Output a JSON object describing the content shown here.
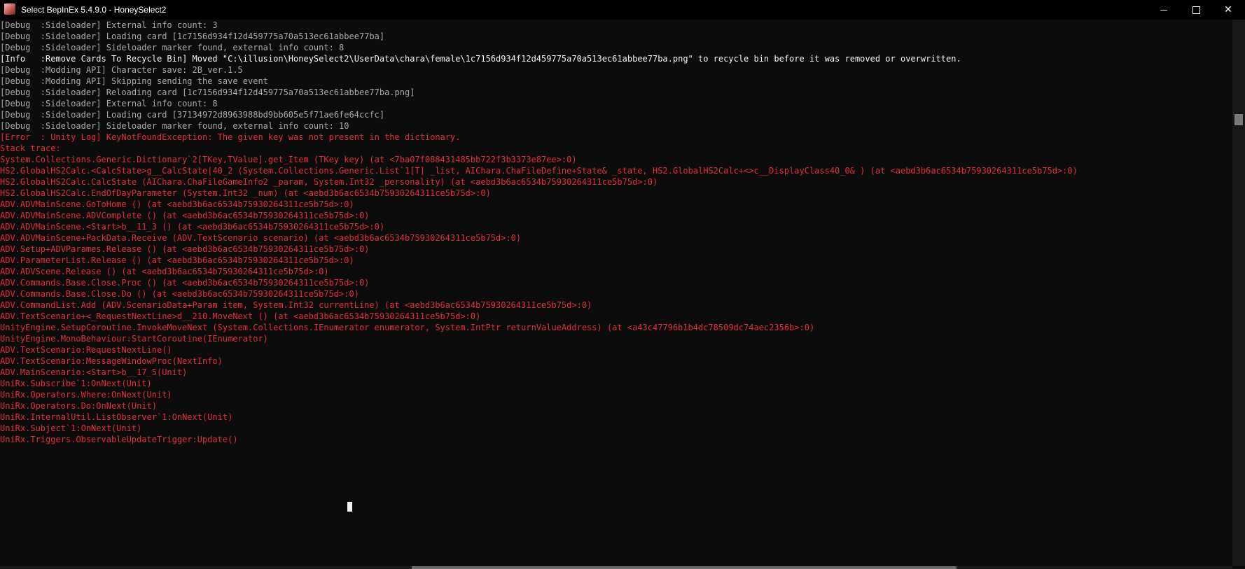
{
  "titlebar": {
    "title": "Select BepInEx 5.4.9.0 - HoneySelect2",
    "icon": "honeyselect2-app-icon",
    "minimize_glyph": "",
    "maximize_glyph": "",
    "close_glyph": "✕"
  },
  "colors": {
    "debug": "#a9a9a9",
    "info": "#f2f2f2",
    "error": "#e02f3b",
    "background": "#0c0c0c"
  },
  "console": {
    "lines": [
      {
        "level": "debug",
        "text": "[Debug  :Sideloader] External info count: 3"
      },
      {
        "level": "debug",
        "text": "[Debug  :Sideloader] Loading card [1c7156d934f12d459775a70a513ec61abbee77ba]"
      },
      {
        "level": "debug",
        "text": "[Debug  :Sideloader] Sideloader marker found, external info count: 8"
      },
      {
        "level": "info",
        "text": "[Info   :Remove Cards To Recycle Bin] Moved \"C:\\illusion\\HoneySelect2\\UserData\\chara\\female\\1c7156d934f12d459775a70a513ec61abbee77ba.png\" to recycle bin before it was removed or overwritten."
      },
      {
        "level": "debug",
        "text": "[Debug  :Modding API] Character save: 2B_ver.1.5"
      },
      {
        "level": "debug",
        "text": "[Debug  :Modding API] Skipping sending the save event"
      },
      {
        "level": "debug",
        "text": "[Debug  :Sideloader] Reloading card [1c7156d934f12d459775a70a513ec61abbee77ba.png]"
      },
      {
        "level": "debug",
        "text": "[Debug  :Sideloader] External info count: 8"
      },
      {
        "level": "debug",
        "text": "[Debug  :Sideloader] Loading card [37134972d8963988bd9bb605e5f71ae6fe64ccfc]"
      },
      {
        "level": "debug",
        "text": "[Debug  :Sideloader] Sideloader marker found, external info count: 10"
      },
      {
        "level": "error",
        "text": "[Error  : Unity Log] KeyNotFoundException: The given key was not present in the dictionary."
      },
      {
        "level": "error",
        "text": "Stack trace:"
      },
      {
        "level": "error",
        "text": "System.Collections.Generic.Dictionary`2[TKey,TValue].get_Item (TKey key) (at <7ba07f088431485bb722f3b3373e87ee>:0)"
      },
      {
        "level": "error",
        "text": "HS2.GlobalHS2Calc.<CalcState>g__CalcState|40_2 (System.Collections.Generic.List`1[T] _list, AIChara.ChaFileDefine+State& _state, HS2.GlobalHS2Calc+<>c__DisplayClass40_0& ) (at <aebd3b6ac6534b75930264311ce5b75d>:0)"
      },
      {
        "level": "error",
        "text": "HS2.GlobalHS2Calc.CalcState (AIChara.ChaFileGameInfo2 _param, System.Int32 _personality) (at <aebd3b6ac6534b75930264311ce5b75d>:0)"
      },
      {
        "level": "error",
        "text": "HS2.GlobalHS2Calc.EndOfDayParameter (System.Int32 _num) (at <aebd3b6ac6534b75930264311ce5b75d>:0)"
      },
      {
        "level": "error",
        "text": "ADV.ADVMainScene.GoToHome () (at <aebd3b6ac6534b75930264311ce5b75d>:0)"
      },
      {
        "level": "error",
        "text": "ADV.ADVMainScene.ADVComplete () (at <aebd3b6ac6534b75930264311ce5b75d>:0)"
      },
      {
        "level": "error",
        "text": "ADV.ADVMainScene.<Start>b__11_3 () (at <aebd3b6ac6534b75930264311ce5b75d>:0)"
      },
      {
        "level": "error",
        "text": "ADV.ADVMainScene+PackData.Receive (ADV.TextScenario scenario) (at <aebd3b6ac6534b75930264311ce5b75d>:0)"
      },
      {
        "level": "error",
        "text": "ADV.Setup+ADVParames.Release () (at <aebd3b6ac6534b75930264311ce5b75d>:0)"
      },
      {
        "level": "error",
        "text": "ADV.ParameterList.Release () (at <aebd3b6ac6534b75930264311ce5b75d>:0)"
      },
      {
        "level": "error",
        "text": "ADV.ADVScene.Release () (at <aebd3b6ac6534b75930264311ce5b75d>:0)"
      },
      {
        "level": "error",
        "text": "ADV.Commands.Base.Close.Proc () (at <aebd3b6ac6534b75930264311ce5b75d>:0)"
      },
      {
        "level": "error",
        "text": "ADV.Commands.Base.Close.Do () (at <aebd3b6ac6534b75930264311ce5b75d>:0)"
      },
      {
        "level": "error",
        "text": "ADV.CommandList.Add (ADV.ScenarioData+Param item, System.Int32 currentLine) (at <aebd3b6ac6534b75930264311ce5b75d>:0)"
      },
      {
        "level": "error",
        "text": "ADV.TextScenario+<_RequestNextLine>d__210.MoveNext () (at <aebd3b6ac6534b75930264311ce5b75d>:0)"
      },
      {
        "level": "error",
        "text": "UnityEngine.SetupCoroutine.InvokeMoveNext (System.Collections.IEnumerator enumerator, System.IntPtr returnValueAddress) (at <a43c47796b1b4dc78509dc74aec2356b>:0)"
      },
      {
        "level": "error",
        "text": "UnityEngine.MonoBehaviour:StartCoroutine(IEnumerator)"
      },
      {
        "level": "error",
        "text": "ADV.TextScenario:RequestNextLine()"
      },
      {
        "level": "error",
        "text": "ADV.TextScenario:MessageWindowProc(NextInfo)"
      },
      {
        "level": "error",
        "text": "ADV.MainScenario:<Start>b__17_5(Unit)"
      },
      {
        "level": "error",
        "text": "UniRx.Subscribe`1:OnNext(Unit)"
      },
      {
        "level": "error",
        "text": "UniRx.Operators.Where:OnNext(Unit)"
      },
      {
        "level": "error",
        "text": "UniRx.Operators.Do:OnNext(Unit)"
      },
      {
        "level": "error",
        "text": "UniRx.InternalUtil.ListObserver`1:OnNext(Unit)"
      },
      {
        "level": "error",
        "text": "UniRx.Subject`1:OnNext(Unit)"
      },
      {
        "level": "error",
        "text": "UniRx.Triggers.ObservableUpdateTrigger:Update()"
      }
    ]
  }
}
